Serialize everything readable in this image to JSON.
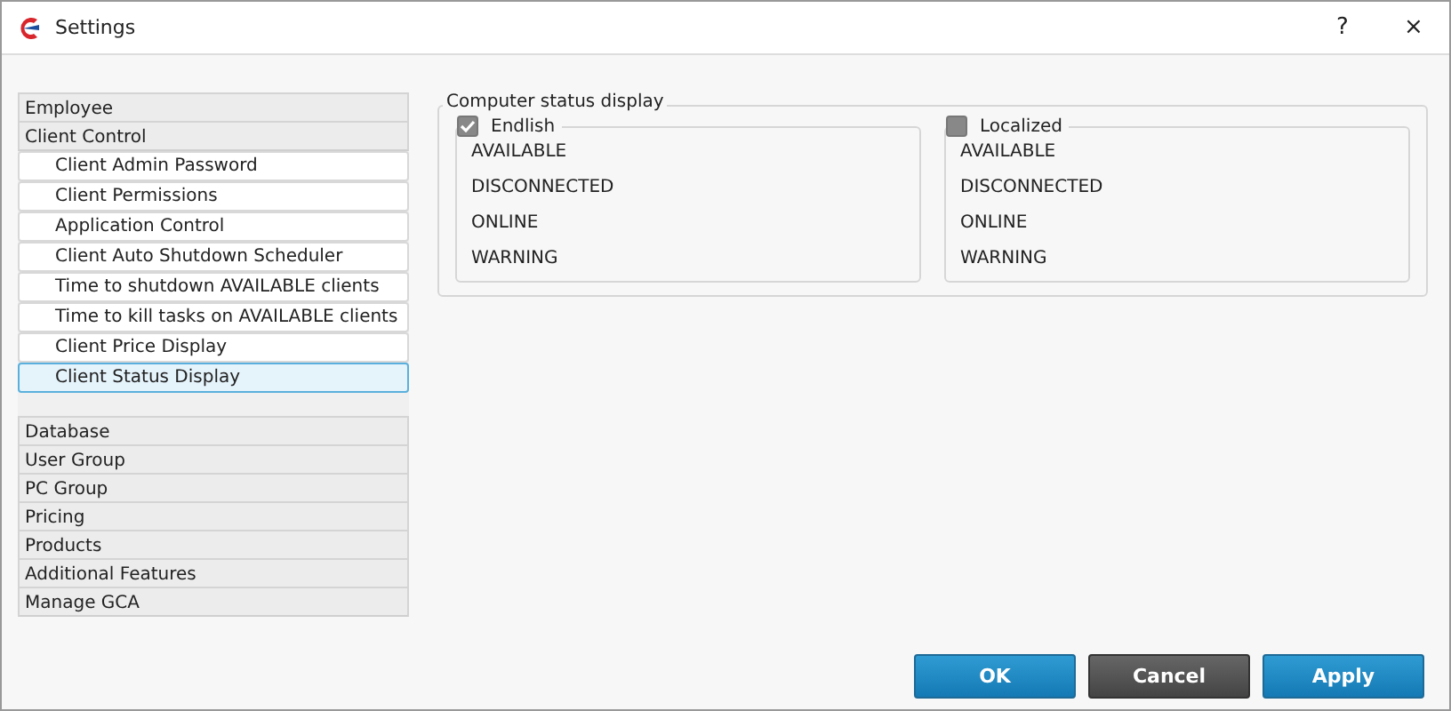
{
  "window": {
    "title": "Settings",
    "help": "?",
    "close": "×"
  },
  "sidebar": {
    "items": [
      {
        "label": "Employee",
        "selected": false
      },
      {
        "label": "Client Control",
        "selected": false,
        "children": [
          {
            "label": "Client Admin Password",
            "selected": false
          },
          {
            "label": "Client Permissions",
            "selected": false
          },
          {
            "label": "Application Control",
            "selected": false
          },
          {
            "label": "Client Auto Shutdown Scheduler",
            "selected": false
          },
          {
            "label": "Time to shutdown AVAILABLE clients",
            "selected": false
          },
          {
            "label": "Time to kill tasks on AVAILABLE clients",
            "selected": false
          },
          {
            "label": "Client Price Display",
            "selected": false
          },
          {
            "label": "Client Status Display",
            "selected": true
          }
        ]
      },
      {
        "label": "Database",
        "selected": false
      },
      {
        "label": "User Group",
        "selected": false
      },
      {
        "label": "PC Group",
        "selected": false
      },
      {
        "label": "Pricing",
        "selected": false
      },
      {
        "label": "Products",
        "selected": false
      },
      {
        "label": "Additional Features",
        "selected": false
      },
      {
        "label": "Manage GCA",
        "selected": false
      }
    ]
  },
  "status_display": {
    "title": "Computer status display",
    "groups": [
      {
        "label": "Endlish",
        "checked": true,
        "statuses": [
          "AVAILABLE",
          "DISCONNECTED",
          "ONLINE",
          "WARNING"
        ]
      },
      {
        "label": "Localized",
        "checked": false,
        "statuses": [
          "AVAILABLE",
          "DISCONNECTED",
          "ONLINE",
          "WARNING"
        ]
      }
    ]
  },
  "buttons": [
    {
      "label": "OK",
      "kind": "primary"
    },
    {
      "label": "Cancel",
      "kind": "secondary"
    },
    {
      "label": "Apply",
      "kind": "primary"
    }
  ]
}
